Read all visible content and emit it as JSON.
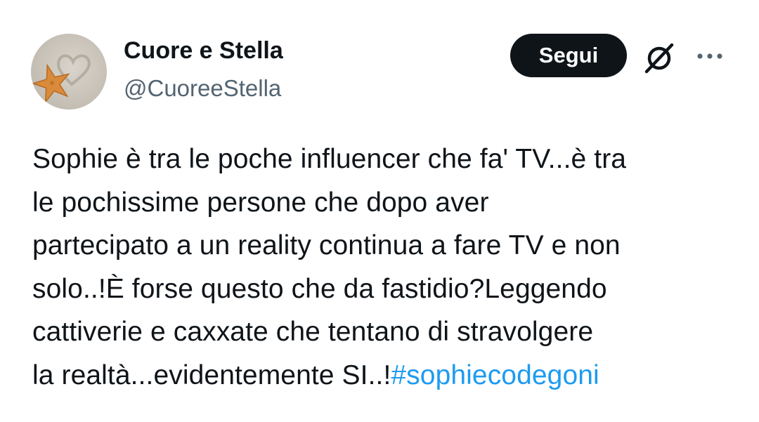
{
  "author": {
    "display_name": "Cuore e Stella",
    "handle": "@CuoreeStella"
  },
  "actions": {
    "follow_label": "Segui",
    "grok_icon": "grok-icon",
    "more_icon": "more-dots-icon"
  },
  "tweet": {
    "text": "Sophie è tra le poche influencer che fa' TV...è tra\nle pochissime persone che dopo aver\npartecipato a un reality continua a fare TV e non\nsolo..!È forse questo che da fastidio?Leggendo\ncattiverie e caxxate che tentano di stravolgere\nla realtà...evidentemente SI..!",
    "hashtag": "#sophiecodegoni"
  },
  "colors": {
    "text": "#0f1419",
    "secondary": "#536471",
    "link": "#1d9bf0",
    "button_bg": "#0f1419"
  }
}
